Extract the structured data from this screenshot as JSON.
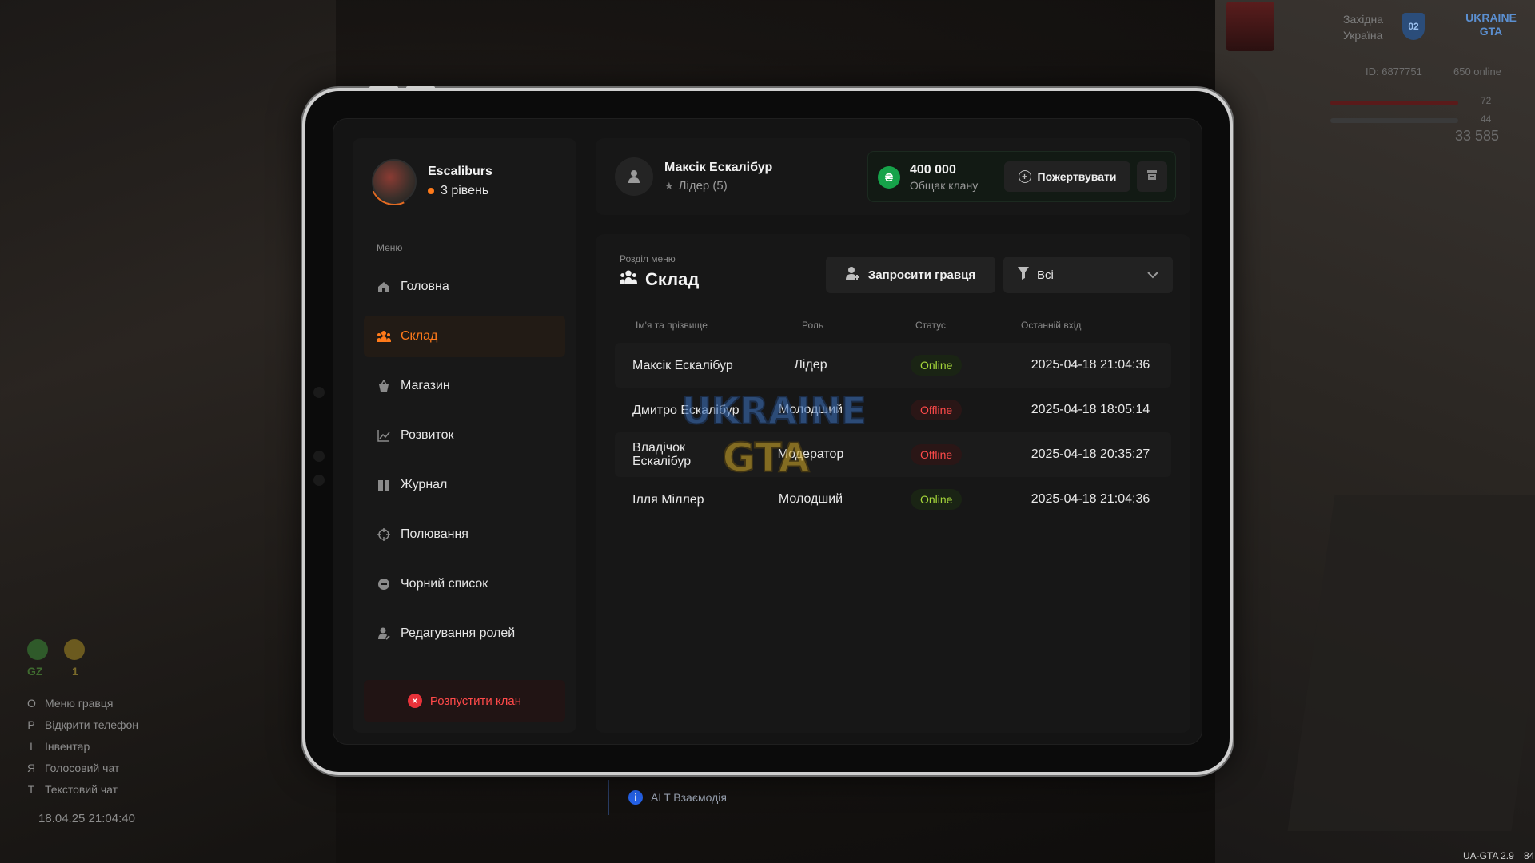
{
  "profile": {
    "name": "Escaliburs",
    "level": "3 рівень"
  },
  "menu": {
    "caption": "Меню",
    "items": [
      {
        "label": "Головна",
        "icon": "home-icon",
        "active": false
      },
      {
        "label": "Склад",
        "icon": "members-icon",
        "active": true
      },
      {
        "label": "Магазин",
        "icon": "shop-icon",
        "active": false
      },
      {
        "label": "Розвиток",
        "icon": "chart-icon",
        "active": false
      },
      {
        "label": "Журнал",
        "icon": "book-icon",
        "active": false
      },
      {
        "label": "Полювання",
        "icon": "crosshair-icon",
        "active": false
      },
      {
        "label": "Чорний список",
        "icon": "blocked-icon",
        "active": false
      },
      {
        "label": "Редагування ролей",
        "icon": "user-edit-icon",
        "active": false
      }
    ],
    "disband_label": "Розпустити клан"
  },
  "header": {
    "user_name": "Максік Ескалібур",
    "user_role": "Лідер (5)",
    "bank_amount": "400 000",
    "bank_label": "Общак клану",
    "donate_label": "Пожертвувати"
  },
  "section": {
    "caption": "Розділ меню",
    "title": "Склад",
    "invite_label": "Запросити гравця",
    "filter_value": "Всі"
  },
  "table": {
    "columns": [
      "Ім'я та прізвище",
      "Роль",
      "Статус",
      "Останній вхід"
    ],
    "rows": [
      {
        "name": "Максік Ескалібур",
        "role": "Лідер",
        "status": "Online",
        "last": "2025-04-18 21:04:36"
      },
      {
        "name": "Дмитро Ескалібур",
        "role": "Молодший",
        "status": "Offline",
        "last": "2025-04-18 18:05:14"
      },
      {
        "name": "Владічок Ескалібур",
        "role": "Модератор",
        "status": "Offline",
        "last": "2025-04-18 20:35:27"
      },
      {
        "name": "Ілля Міллер",
        "role": "Молодший",
        "status": "Online",
        "last": "2025-04-18 21:04:36"
      }
    ]
  },
  "watermark": {
    "line1": "UKRAINE",
    "line2": "GTA"
  },
  "hud": {
    "region": [
      "Західна",
      "Україна"
    ],
    "region_num": "02",
    "logo_text": "UKRAINE GTA",
    "player_id": "ID: 6877751",
    "online": "650 online",
    "health": "72",
    "armor": "44",
    "money": "33 585",
    "gz_label": "GZ",
    "star_count": "1",
    "keys": [
      {
        "key": "O",
        "label": "Меню гравця"
      },
      {
        "key": "P",
        "label": "Відкрити телефон"
      },
      {
        "key": "I",
        "label": "Інвентар"
      },
      {
        "key": "Я",
        "label": "Голосовий чат"
      },
      {
        "key": "T",
        "label": "Текстовий чат"
      }
    ],
    "datetime": "18.04.25 21:04:40",
    "hint": "ALT Взаємодія",
    "version": "UA-GTA 2.9",
    "fps": "84"
  },
  "colors": {
    "accent": "#ff7a1a",
    "online": "#a5d63a",
    "offline": "#ff4a4a",
    "bank_coin": "#16a34a"
  }
}
